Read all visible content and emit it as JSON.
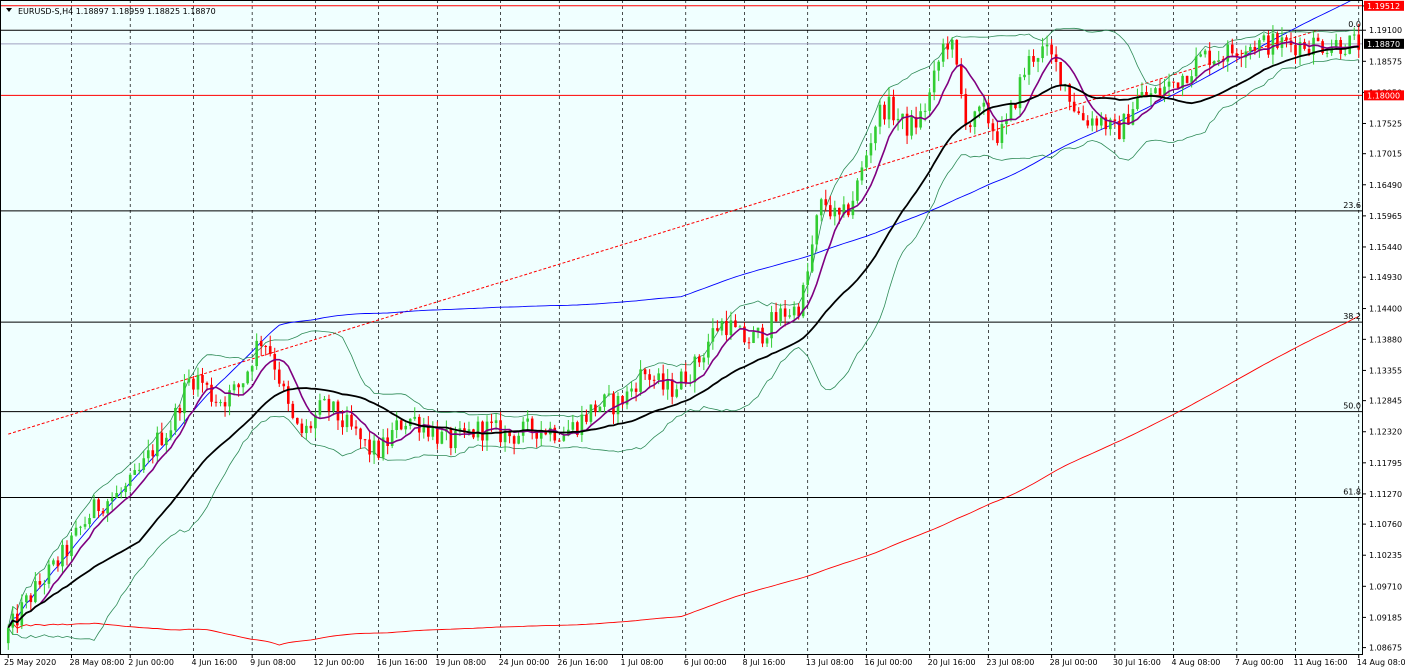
{
  "header": {
    "symbol_line": "EURUSD-S,H4  1.18897 1.18959 1.18825 1.18870"
  },
  "colors": {
    "background": "#F0FFFF",
    "grid": "#000000",
    "bull": "#32CD32",
    "bear": "#FF0000",
    "ma_fast": "#800080",
    "ma_slow": "#000000",
    "bollinger": "#2E8B57",
    "ma_long_blue": "#0000FF",
    "ma_long_red": "#FF0000",
    "hline_red": "#FF0000",
    "fib": "#000000",
    "price_line": "#A0A0C0",
    "trendline": "#FF0000"
  },
  "chart_data": {
    "type": "candlestick",
    "symbol": "EURUSD-S",
    "timeframe": "H4",
    "ohlc_last": {
      "open": 1.18897,
      "high": 1.18959,
      "low": 1.18825,
      "close": 1.1887
    },
    "ylim": [
      1.0855,
      1.1961
    ],
    "y_ticks": [
      "1.19510",
      "1.19100",
      "1.18575",
      "1.18050",
      "1.17525",
      "1.17015",
      "1.16490",
      "1.15965",
      "1.15440",
      "1.14930",
      "1.14400",
      "1.13880",
      "1.13355",
      "1.12845",
      "1.12320",
      "1.11795",
      "1.11270",
      "1.10760",
      "1.10235",
      "1.09710",
      "1.09185",
      "1.08675"
    ],
    "x_ticks": [
      "25 May 2020",
      "28 May 08:00",
      "2 Jun 00:00",
      "4 Jun 16:00",
      "9 Jun 08:00",
      "12 Jun 00:00",
      "16 Jun 16:00",
      "19 Jun 08:00",
      "24 Jun 00:00",
      "26 Jun 16:00",
      "1 Jul 08:00",
      "6 Jul 00:00",
      "8 Jul 16:00",
      "13 Jul 08:00",
      "16 Jul 00:00",
      "20 Jul 16:00",
      "23 Jul 08:00",
      "28 Jul 00:00",
      "30 Jul 16:00",
      "4 Aug 08:00",
      "7 Aug 00:00",
      "11 Aug 16:00",
      "14 Aug 08:00"
    ],
    "horizontal_lines": [
      {
        "price": 1.19512,
        "label": "1.19512",
        "color": "red"
      },
      {
        "price": 1.18,
        "label": "1.18000",
        "color": "red"
      }
    ],
    "current_price": {
      "price": 1.1887,
      "label": "1.18870"
    },
    "fibonacci": [
      {
        "level": "0.0",
        "price": 1.191
      },
      {
        "level": "23.6",
        "price": 1.1605
      },
      {
        "level": "38.2",
        "price": 1.1417
      },
      {
        "level": "50.0",
        "price": 1.1266
      },
      {
        "level": "61.8",
        "price": 1.1121
      }
    ],
    "trendline": {
      "from": {
        "t": 0,
        "price": 1.1228
      },
      "to": {
        "t": 290,
        "price": 1.191
      }
    },
    "n_bars": 300,
    "close": [
      1.0895,
      1.0905,
      1.0918,
      1.0931,
      1.0944,
      1.0955,
      1.0965,
      1.0975,
      1.0984,
      1.0993,
      1.1002,
      1.1012,
      1.1022,
      1.1033,
      1.1044,
      1.1056,
      1.1068,
      1.108,
      1.1091,
      1.11,
      1.1108,
      1.1114,
      1.1118,
      1.1121,
      1.1124,
      1.1128,
      1.1134,
      1.1141,
      1.1151,
      1.1162,
      1.1175,
      1.1189,
      1.1203,
      1.1216,
      1.1226,
      1.1232,
      1.1242,
      1.126,
      1.1283,
      1.1302,
      1.1318,
      1.1323,
      1.1322,
      1.1315,
      1.1304,
      1.1294,
      1.1288,
      1.1287,
      1.129,
      1.1294,
      1.13,
      1.1308,
      1.132,
      1.1338,
      1.1358,
      1.1377,
      1.1388,
      1.1384,
      1.1369,
      1.1347,
      1.1323,
      1.1296,
      1.127,
      1.1248,
      1.1235,
      1.123,
      1.1234,
      1.1244,
      1.1257,
      1.1268,
      1.1272,
      1.1271,
      1.1264,
      1.1256,
      1.1248,
      1.1241,
      1.1234,
      1.1226,
      1.1217,
      1.1209,
      1.1202,
      1.1199,
      1.12,
      1.1206,
      1.1215,
      1.1227,
      1.1238,
      1.1247,
      1.1252,
      1.1254,
      1.1252,
      1.1249,
      1.1244,
      1.1239,
      1.1233,
      1.1227,
      1.1221,
      1.1217,
      1.1215,
      1.1216,
      1.1219,
      1.1223,
      1.1228,
      1.1232,
      1.1235,
      1.1237,
      1.1237,
      1.1235,
      1.1232,
      1.1229,
      1.1227,
      1.1226,
      1.1227,
      1.1229,
      1.1232,
      1.1235,
      1.1237,
      1.1238,
      1.1238,
      1.1237,
      1.1235,
      1.1234,
      1.1233,
      1.1234,
      1.1236,
      1.124,
      1.1246,
      1.1253,
      1.126,
      1.1267,
      1.1273,
      1.1277,
      1.1279,
      1.1279,
      1.1279,
      1.1281,
      1.1286,
      1.1294,
      1.1306,
      1.1318,
      1.1327,
      1.133,
      1.1327,
      1.132,
      1.1312,
      1.1306,
      1.1304,
      1.1306,
      1.1312,
      1.132,
      1.1328,
      1.1335,
      1.1343,
      1.1354,
      1.1369,
      1.1385,
      1.1399,
      1.141,
      1.1415,
      1.1414,
      1.1408,
      1.1399,
      1.1392,
      1.1388,
      1.1387,
      1.1389,
      1.1394,
      1.14,
      1.1407,
      1.1415,
      1.1422,
      1.1429,
      1.1434,
      1.1436,
      1.1438,
      1.1446,
      1.1466,
      1.15,
      1.1543,
      1.1585,
      1.1613,
      1.1618,
      1.1607,
      1.1594,
      1.1589,
      1.1596,
      1.1611,
      1.1628,
      1.1648,
      1.1673,
      1.1701,
      1.1729,
      1.1754,
      1.1771,
      1.1779,
      1.1778,
      1.1771,
      1.1761,
      1.1752,
      1.1747,
      1.1748,
      1.1754,
      1.1765,
      1.178,
      1.18,
      1.1826,
      1.1856,
      1.1882,
      1.1892,
      1.1877,
      1.1842,
      1.1799,
      1.1766,
      1.1752,
      1.1756,
      1.1767,
      1.177,
      1.176,
      1.1745,
      1.1735,
      1.1736,
      1.1749,
      1.177,
      1.1795,
      1.1819,
      1.184,
      1.1857,
      1.1868,
      1.1874,
      1.1874,
      1.1869,
      1.186,
      1.1849,
      1.1836,
      1.1819,
      1.18,
      1.1782,
      1.1769,
      1.1762,
      1.176,
      1.1761,
      1.1762,
      1.1759,
      1.1752,
      1.1744,
      1.1739,
      1.1742,
      1.1752,
      1.1768,
      1.1784,
      1.1794,
      1.1798,
      1.1799,
      1.18,
      1.1803,
      1.1807,
      1.1812,
      1.1817,
      1.1821,
      1.1827,
      1.1834,
      1.1841,
      1.1849,
      1.1856,
      1.1862,
      1.1866,
      1.1867,
      1.1867,
      1.1867,
      1.1869,
      1.1872,
      1.1875,
      1.1879,
      1.1882,
      1.1884,
      1.1886,
      1.1887,
      1.1887,
      1.1887,
      1.1887,
      1.1887,
      1.1887,
      1.1887,
      1.1887,
      1.1887,
      1.1887,
      1.1887,
      1.1887,
      1.1887,
      1.1887,
      1.1887,
      1.1887,
      1.1887,
      1.1887,
      1.1887,
      1.1887,
      1.1887,
      1.1887,
      1.1887,
      1.1887,
      1.1887,
      1.1887
    ]
  }
}
